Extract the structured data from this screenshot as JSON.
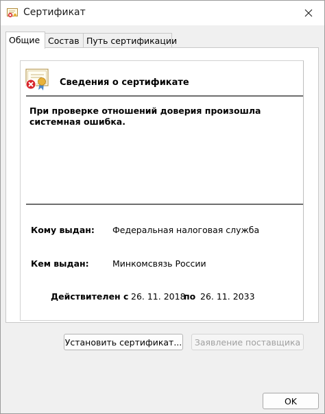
{
  "window": {
    "title": "Сертификат"
  },
  "tabs": [
    {
      "label": "Общие",
      "active": true
    },
    {
      "label": "Состав",
      "active": false
    },
    {
      "label": "Путь сертификации",
      "active": false
    }
  ],
  "info": {
    "title": "Сведения о сертификате",
    "error_message": "При проверке отношений доверия произошла системная ошибка."
  },
  "fields": {
    "issued_to_label": "Кому выдан:",
    "issued_to_value": "Федеральная налоговая служба",
    "issued_by_label": "Кем выдан:",
    "issued_by_value": "Минкомсвязь России",
    "valid_from_label": "Действителен с",
    "valid_from_value": "26. 11. 2018",
    "valid_to_label": "по",
    "valid_to_value": "26. 11. 2033"
  },
  "buttons": {
    "install_label": "Установить сертификат...",
    "issuer_statement_label": "Заявление поставщика",
    "ok_label": "OK"
  },
  "icons": {
    "app": "certificate-icon",
    "close": "close-icon",
    "cert_error": "certificate-error-icon"
  },
  "colors": {
    "error_red": "#d8262b",
    "seal_gold": "#e8b23a",
    "ribbon_blue": "#4a86c8"
  }
}
